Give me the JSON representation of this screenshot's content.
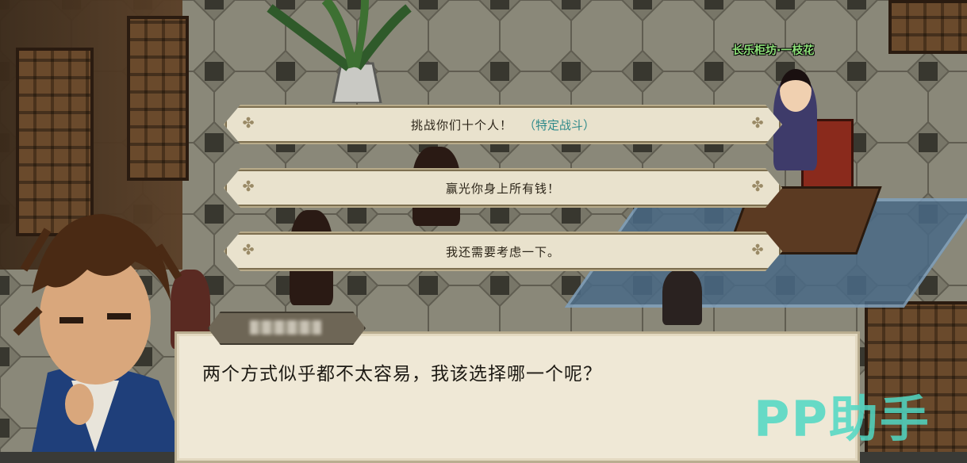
{
  "npc": {
    "name_label": "长乐柜坊·一枝花"
  },
  "choices": [
    {
      "text": "挑战你们十个人！",
      "tag": "（特定战斗）"
    },
    {
      "text": "赢光你身上所有钱！",
      "tag": ""
    },
    {
      "text": "我还需要考虑一下。",
      "tag": ""
    }
  ],
  "dialog": {
    "text": "两个方式似乎都不太容易，我该选择哪一个呢？"
  },
  "watermark": {
    "text": "PP助手"
  },
  "colors": {
    "npc_name": "#8fe27a",
    "choice_tag": "#2f8a8a",
    "dialog_bg": "#efe8d6",
    "watermark": "#4fd8c4"
  }
}
